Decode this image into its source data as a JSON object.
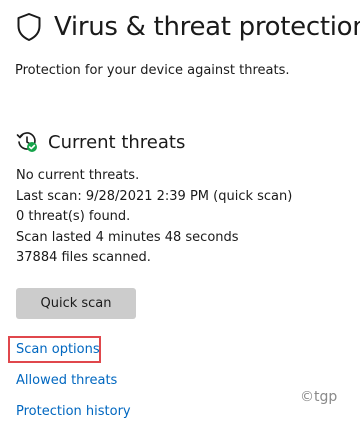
{
  "header": {
    "title": "Virus & threat protection",
    "icon": "shield-icon"
  },
  "subtitle": "Protection for your device against threats.",
  "current_threats": {
    "title": "Current threats",
    "icon": "threat-clock-check-icon",
    "status_lines": [
      "No current threats.",
      "Last scan: 9/28/2021 2:39 PM (quick scan)",
      "0 threat(s) found.",
      "Scan lasted 4 minutes 48 seconds",
      "37884 files scanned."
    ],
    "quick_scan_label": "Quick scan"
  },
  "links": {
    "scan_options": "Scan options",
    "allowed_threats": "Allowed threats",
    "protection_history": "Protection history"
  },
  "watermark": "©tgp",
  "colors": {
    "link": "#0067c0",
    "button_bg": "#cccccc",
    "highlight": "#e0474c",
    "check_badge": "#16a34a"
  }
}
